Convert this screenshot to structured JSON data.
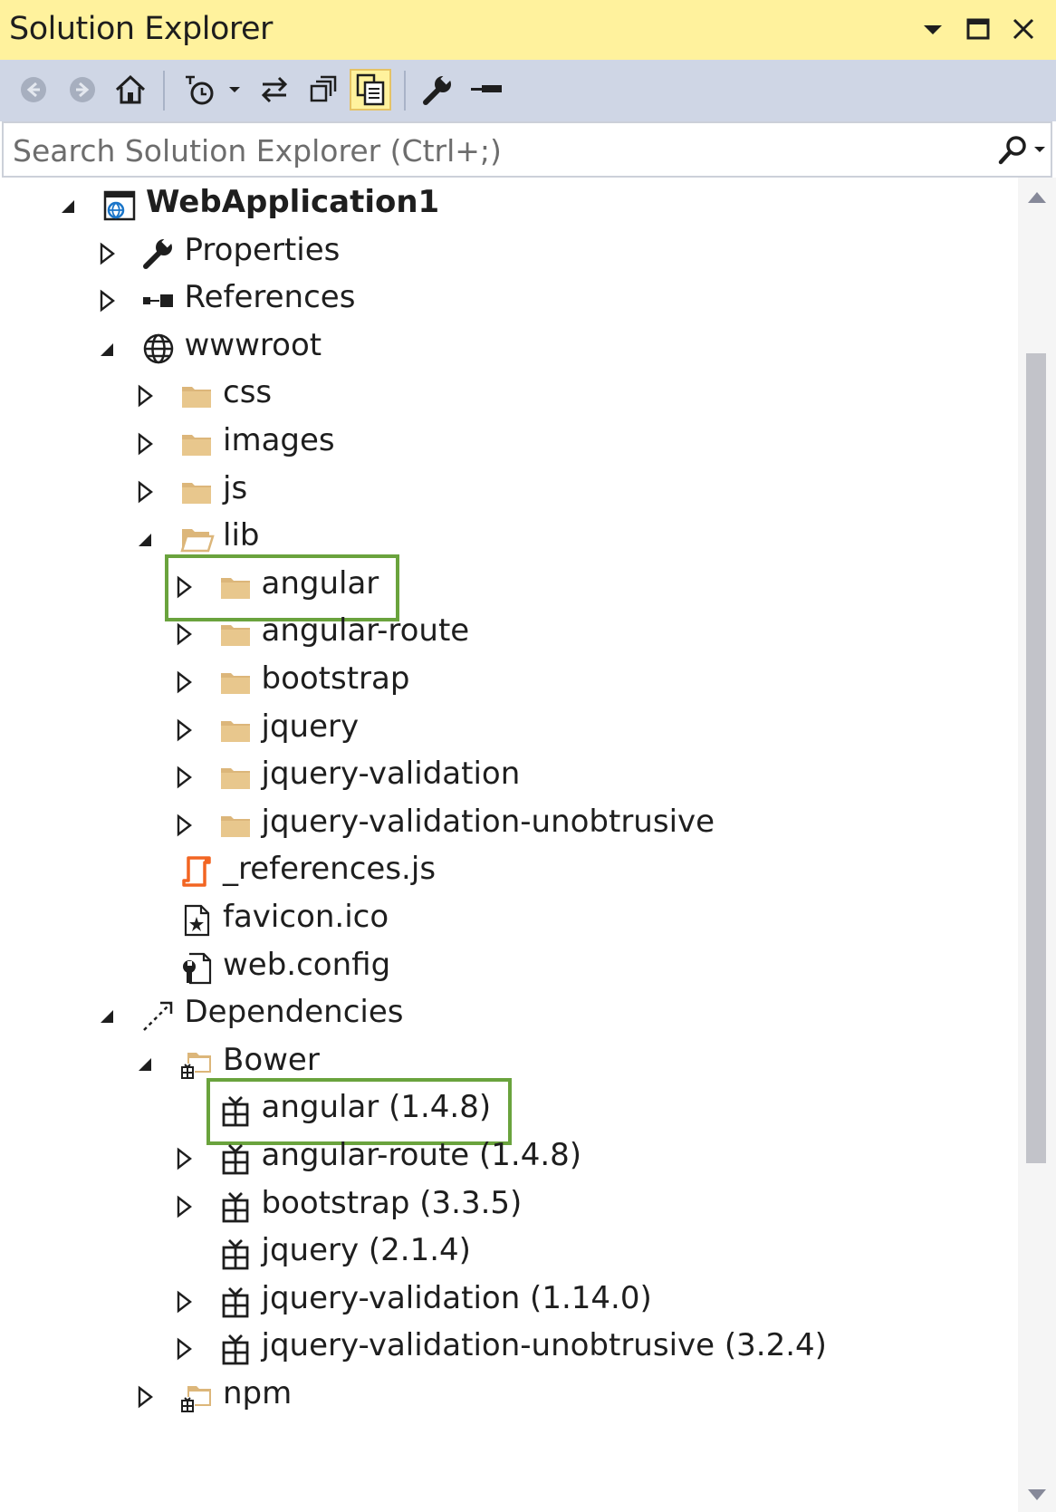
{
  "window": {
    "title": "Solution Explorer"
  },
  "toolbar": {
    "buttons": [
      {
        "name": "back-icon"
      },
      {
        "name": "forward-icon"
      },
      {
        "name": "home-icon"
      },
      {
        "name": "pending-changes-icon"
      },
      {
        "name": "sync-icon"
      },
      {
        "name": "collapse-all-icon"
      },
      {
        "name": "show-all-files-icon",
        "active": true
      },
      {
        "name": "properties-wrench-icon"
      },
      {
        "name": "preview-icon"
      }
    ]
  },
  "search": {
    "placeholder": "Search Solution Explorer (Ctrl+;)"
  },
  "tree": [
    {
      "label": "WebApplication1",
      "depth": 0,
      "expander": "expanded",
      "icon": "web-project-icon",
      "bold": true
    },
    {
      "label": "Properties",
      "depth": 1,
      "expander": "collapsed",
      "icon": "wrench-icon"
    },
    {
      "label": "References",
      "depth": 1,
      "expander": "collapsed",
      "icon": "references-icon"
    },
    {
      "label": "wwwroot",
      "depth": 1,
      "expander": "expanded",
      "icon": "globe-icon"
    },
    {
      "label": "css",
      "depth": 2,
      "expander": "collapsed",
      "icon": "folder-icon"
    },
    {
      "label": "images",
      "depth": 2,
      "expander": "collapsed",
      "icon": "folder-icon"
    },
    {
      "label": "js",
      "depth": 2,
      "expander": "collapsed",
      "icon": "folder-icon"
    },
    {
      "label": "lib",
      "depth": 2,
      "expander": "expanded",
      "icon": "folder-open-icon"
    },
    {
      "label": "angular",
      "depth": 3,
      "expander": "collapsed",
      "icon": "folder-icon",
      "highlight": true
    },
    {
      "label": "angular-route",
      "depth": 3,
      "expander": "collapsed",
      "icon": "folder-icon"
    },
    {
      "label": "bootstrap",
      "depth": 3,
      "expander": "collapsed",
      "icon": "folder-icon"
    },
    {
      "label": "jquery",
      "depth": 3,
      "expander": "collapsed",
      "icon": "folder-icon"
    },
    {
      "label": "jquery-validation",
      "depth": 3,
      "expander": "collapsed",
      "icon": "folder-icon"
    },
    {
      "label": "jquery-validation-unobtrusive",
      "depth": 3,
      "expander": "collapsed",
      "icon": "folder-icon"
    },
    {
      "label": "_references.js",
      "depth": 2,
      "expander": "none",
      "icon": "js-file-icon"
    },
    {
      "label": "favicon.ico",
      "depth": 2,
      "expander": "none",
      "icon": "ico-file-icon"
    },
    {
      "label": "web.config",
      "depth": 2,
      "expander": "none",
      "icon": "config-file-icon"
    },
    {
      "label": "Dependencies",
      "depth": 1,
      "expander": "expanded",
      "icon": "dependencies-icon"
    },
    {
      "label": "Bower",
      "depth": 2,
      "expander": "expanded",
      "icon": "package-folder-icon"
    },
    {
      "label": "angular (1.4.8)",
      "depth": 3,
      "expander": "none",
      "icon": "package-icon",
      "highlight": true
    },
    {
      "label": "angular-route (1.4.8)",
      "depth": 3,
      "expander": "collapsed",
      "icon": "package-icon"
    },
    {
      "label": "bootstrap (3.3.5)",
      "depth": 3,
      "expander": "collapsed",
      "icon": "package-icon"
    },
    {
      "label": "jquery (2.1.4)",
      "depth": 3,
      "expander": "none",
      "icon": "package-icon"
    },
    {
      "label": "jquery-validation (1.14.0)",
      "depth": 3,
      "expander": "collapsed",
      "icon": "package-icon"
    },
    {
      "label": "jquery-validation-unobtrusive (3.2.4)",
      "depth": 3,
      "expander": "collapsed",
      "icon": "package-icon"
    },
    {
      "label": "npm",
      "depth": 2,
      "expander": "collapsed",
      "icon": "package-folder-icon"
    }
  ],
  "colors": {
    "title_bg": "#fff29d",
    "toolbar_bg": "#cfd6e5",
    "highlight_border": "#6aa33d",
    "folder": "#dcb67a"
  }
}
